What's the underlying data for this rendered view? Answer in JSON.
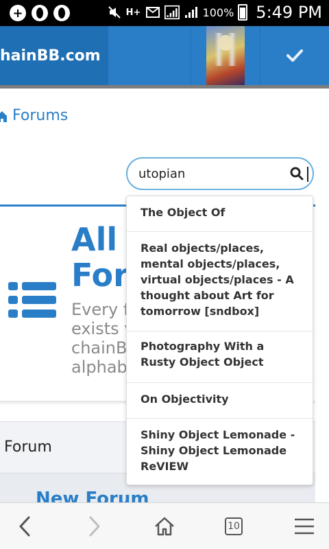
{
  "status_bar": {
    "time": "5:49 PM",
    "battery_percent": "100%",
    "icons": [
      "plus-circle-icon",
      "opera-icon",
      "opera-icon",
      "mute-icon",
      "hplus-signal-icon",
      "message-icon",
      "signal-icon",
      "signal-icon",
      "battery-icon"
    ]
  },
  "header": {
    "site_name": "hainBB.com",
    "brand_color": "#2a7ec8",
    "check_icon": "check-icon"
  },
  "breadcrumb": {
    "label": "Forums",
    "icon": "home-icon"
  },
  "search": {
    "value": "utopian",
    "icon": "search-icon"
  },
  "forum_card": {
    "title_line1": "All",
    "title_line2": "Foru",
    "desc_lines": [
      "Every f",
      "exists v",
      "chainB",
      "alphabe"
    ],
    "icon": "list-icon"
  },
  "table": {
    "header_label": "Forum",
    "row_link": "New Forum"
  },
  "dropdown": {
    "items": [
      "The Object Of",
      "Real objects/places, mental objects/places, virtual objects/places - A thought about Art for tomorrow [sndbox]",
      "Photography With a Rusty Object Object",
      "On Objectivity",
      "Shiny Object Lemonade - Shiny Object Lemonade ReVIEW"
    ]
  },
  "bottom_nav": {
    "tabs_count": "10"
  }
}
